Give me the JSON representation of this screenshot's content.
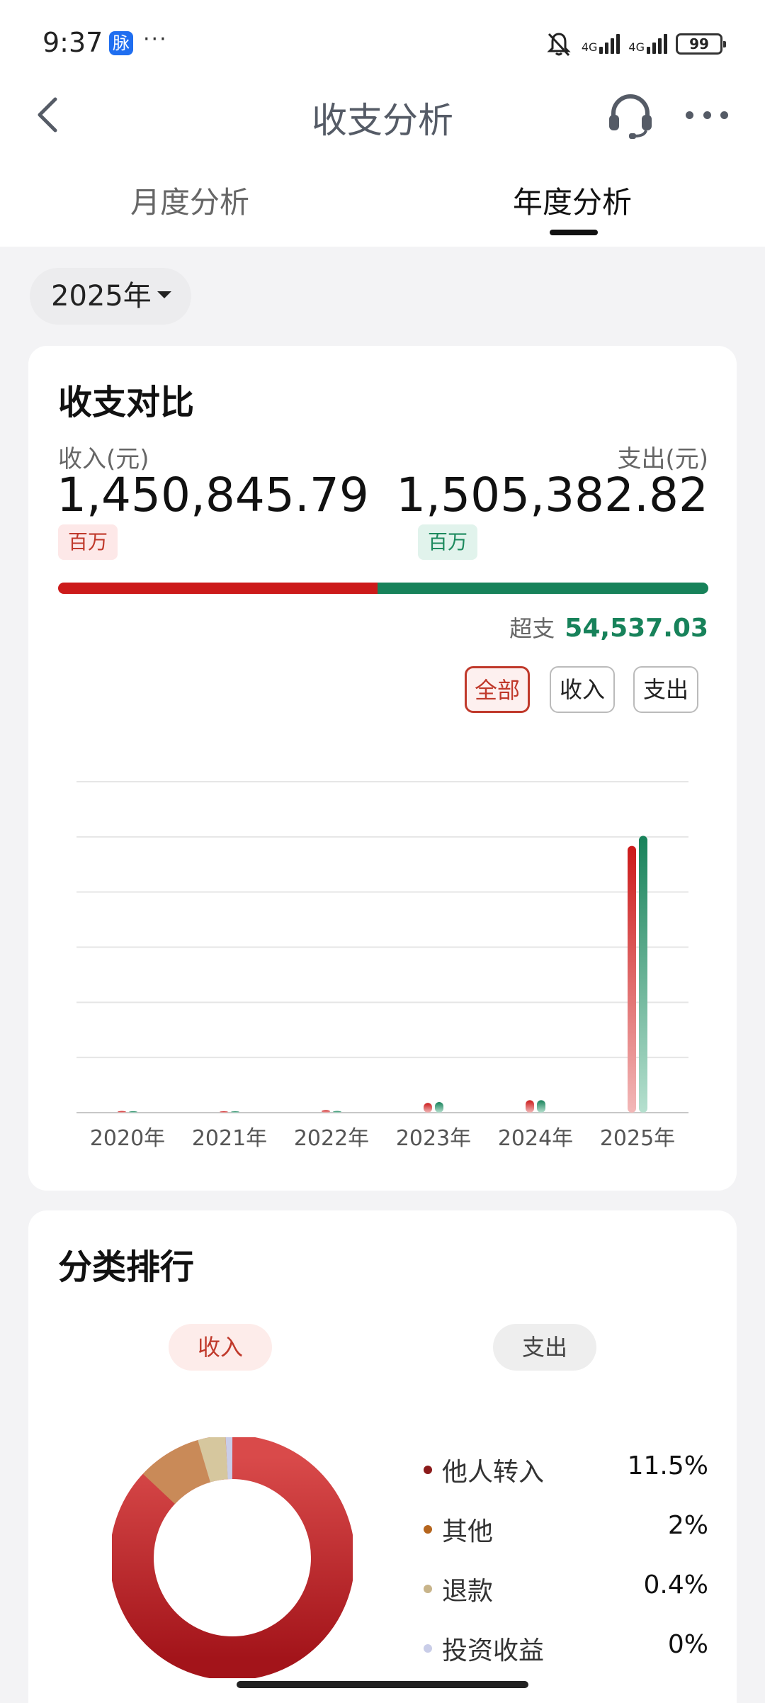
{
  "status": {
    "time": "9:37",
    "app_badge": "脉",
    "more": "···",
    "net1": "4G",
    "net2": "4G",
    "battery": "99"
  },
  "header": {
    "title": "收支分析"
  },
  "tabs": [
    {
      "label": "月度分析"
    },
    {
      "label": "年度分析"
    }
  ],
  "year_selector": {
    "label": "2025年"
  },
  "comparison": {
    "title": "收支对比",
    "income_label": "收入(元)",
    "income_amount": "1,450,845.79",
    "income_unit": "百万",
    "expense_label": "支出(元)",
    "expense_amount": "1,505,382.82",
    "expense_unit": "百万",
    "surplus_label": "超支",
    "surplus_value": "54,537.03",
    "filters": [
      "全部",
      "收入",
      "支出"
    ],
    "colors": {
      "income": "#cc1a1a",
      "expense": "#17825a"
    }
  },
  "chart_data": {
    "type": "bar",
    "categories": [
      "2020年",
      "2021年",
      "2022年",
      "2023年",
      "2024年",
      "2025年"
    ],
    "series": [
      {
        "name": "收入",
        "values": [
          9000,
          6000,
          14000,
          53000,
          68000,
          1450845.79
        ]
      },
      {
        "name": "支出",
        "values": [
          8000,
          7000,
          9000,
          58000,
          68000,
          1505382.82
        ]
      }
    ],
    "ylim": [
      0,
      1800000
    ],
    "grid": true
  },
  "ranking": {
    "title": "分类排行",
    "tab_income": "收入",
    "tab_expense": "支出",
    "items": [
      {
        "name": "他人转入",
        "pct": "11.5%",
        "color": "#8b1a1a"
      },
      {
        "name": "其他",
        "pct": "2%",
        "color": "#b5651d"
      },
      {
        "name": "退款",
        "pct": "0.4%",
        "color": "#c8b48a"
      },
      {
        "name": "投资收益",
        "pct": "0%",
        "color": "#c9cde8"
      }
    ]
  }
}
